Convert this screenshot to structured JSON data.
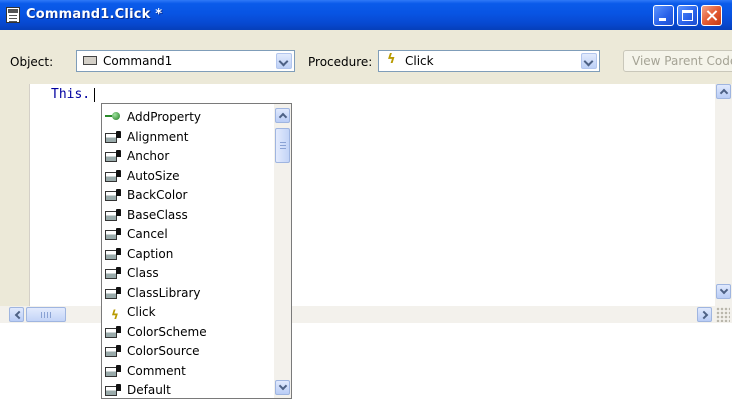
{
  "window": {
    "title": "Command1.Click *"
  },
  "toolbar": {
    "object_label": "Object:",
    "object_value": "Command1",
    "procedure_label": "Procedure:",
    "procedure_value": "Click",
    "view_parent_label": "View Parent Code"
  },
  "editor": {
    "code_line": "This."
  },
  "autocomplete": {
    "items": [
      {
        "label": "AddProperty",
        "kind": "method"
      },
      {
        "label": "Alignment",
        "kind": "property"
      },
      {
        "label": "Anchor",
        "kind": "property"
      },
      {
        "label": "AutoSize",
        "kind": "property"
      },
      {
        "label": "BackColor",
        "kind": "property"
      },
      {
        "label": "BaseClass",
        "kind": "property"
      },
      {
        "label": "Cancel",
        "kind": "property"
      },
      {
        "label": "Caption",
        "kind": "property"
      },
      {
        "label": "Class",
        "kind": "property"
      },
      {
        "label": "ClassLibrary",
        "kind": "property"
      },
      {
        "label": "Click",
        "kind": "event"
      },
      {
        "label": "ColorScheme",
        "kind": "property"
      },
      {
        "label": "ColorSource",
        "kind": "property"
      },
      {
        "label": "Comment",
        "kind": "property"
      },
      {
        "label": "Default",
        "kind": "property"
      }
    ]
  },
  "colors": {
    "titlebar": "#0854e3",
    "code_keyword": "#0000a0",
    "event_icon": "#b89a00"
  }
}
